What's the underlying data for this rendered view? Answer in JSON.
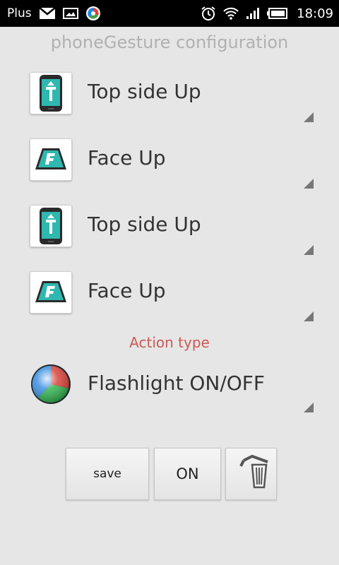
{
  "status_bar": {
    "carrier": "Plus",
    "time": "18:09",
    "icons": [
      "gmail-icon",
      "image-icon",
      "app-ball-icon",
      "alarm-icon",
      "wifi-icon",
      "signal-icon",
      "battery-icon"
    ]
  },
  "title": "phoneGesture configuration",
  "gestures": [
    {
      "label": "Top side Up",
      "icon": "phone-top-up-icon"
    },
    {
      "label": "Face Up",
      "icon": "face-up-icon"
    },
    {
      "label": "Top side Up",
      "icon": "phone-top-up-icon"
    },
    {
      "label": "Face Up",
      "icon": "face-up-icon"
    }
  ],
  "action": {
    "section_label": "Action type",
    "selected": "Flashlight ON/OFF",
    "icon": "flashlight-ball-icon"
  },
  "buttons": {
    "save": "save",
    "toggle": "ON",
    "delete_icon": "trash-icon"
  },
  "colors": {
    "background": "#e6e6e6",
    "title": "#b1b1b1",
    "accent_label": "#cb5a54",
    "icon_teal": "#2fb8b0"
  }
}
